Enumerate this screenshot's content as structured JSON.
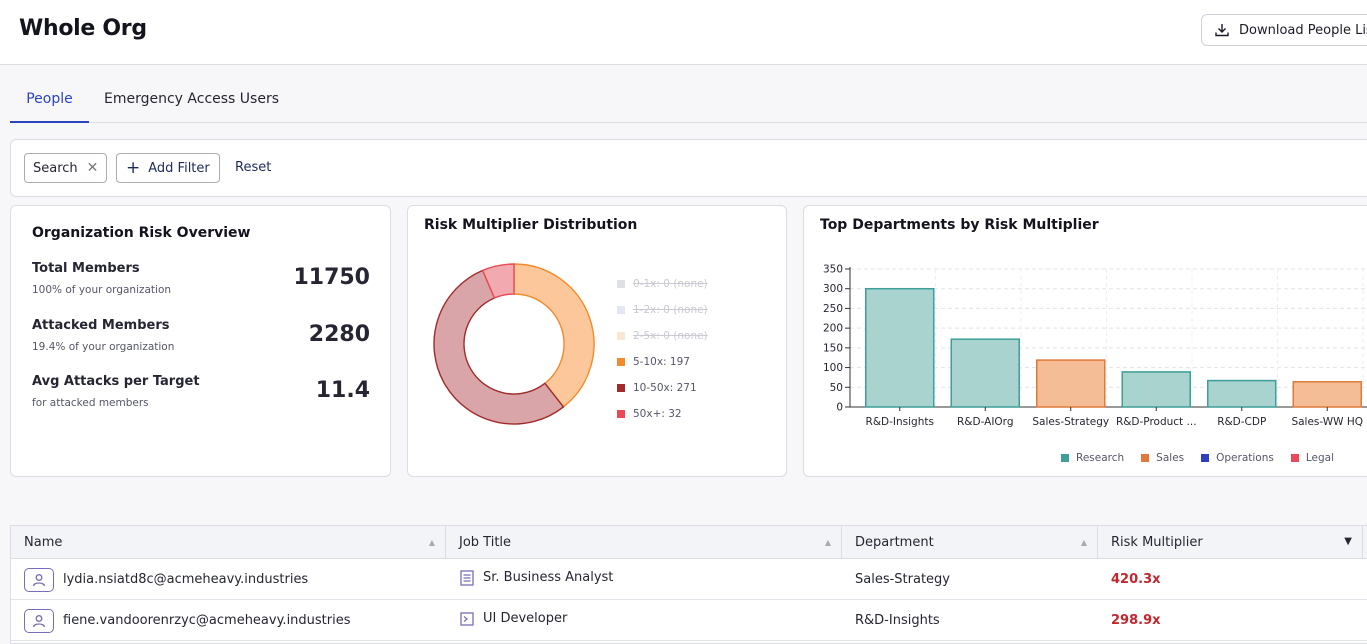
{
  "header": {
    "title": "Whole Org",
    "download_label": "Download People List"
  },
  "tabs": [
    {
      "label": "People",
      "active": true
    },
    {
      "label": "Emergency Access Users",
      "active": false
    }
  ],
  "filters": {
    "search_chip": "Search",
    "add_filter": "Add Filter",
    "reset": "Reset"
  },
  "overview": {
    "title": "Organization Risk Overview",
    "metrics": [
      {
        "label": "Total Members",
        "sub": "100% of your organization",
        "value": "11750"
      },
      {
        "label": "Attacked Members",
        "sub": "19.4% of your organization",
        "value": "2280"
      },
      {
        "label": "Avg Attacks per Target",
        "sub": "for attacked members",
        "value": "11.4"
      }
    ]
  },
  "distribution": {
    "title": "Risk Multiplier Distribution",
    "legend": [
      {
        "label": "0-1x: 0",
        "suffix": "(none)",
        "color": "#dfe0e4",
        "disabled": true
      },
      {
        "label": "1-2x: 0",
        "suffix": "(none)",
        "color": "#e3e8f2",
        "disabled": true
      },
      {
        "label": "2-5x: 0",
        "suffix": "(none)",
        "color": "#fbe8d4",
        "disabled": true
      },
      {
        "label": "5-10x: 197",
        "suffix": "",
        "color": "#f28b2b",
        "disabled": false
      },
      {
        "label": "10-50x: 271",
        "suffix": "",
        "color": "#a12a2a",
        "disabled": false
      },
      {
        "label": "50x+: 32",
        "suffix": "",
        "color": "#e84b55",
        "disabled": false
      }
    ]
  },
  "chart_data": {
    "type": "bar",
    "title": "Top Departments by Risk Multiplier",
    "categories": [
      "R&D-Insights",
      "R&D-AIOrg",
      "Sales-Strategy",
      "R&D-Product ...",
      "R&D-CDP",
      "Sales-WW HQ"
    ],
    "values": [
      300,
      172,
      119,
      89,
      67,
      64
    ],
    "groups": [
      "Research",
      "Research",
      "Sales",
      "Research",
      "Research",
      "Sales"
    ],
    "ylim": [
      0,
      350
    ],
    "yticks": [
      0,
      50,
      100,
      150,
      200,
      250,
      300,
      350
    ],
    "grid": true,
    "legend": [
      {
        "name": "Research",
        "color": "#3e9e98"
      },
      {
        "name": "Sales",
        "color": "#e07a3a"
      },
      {
        "name": "Operations",
        "color": "#2f3fbf"
      },
      {
        "name": "Legal",
        "color": "#e84a5b"
      }
    ],
    "legend_position": "bottom"
  },
  "table": {
    "columns": [
      "Name",
      "Job Title",
      "Department",
      "Risk Multiplier"
    ],
    "rows": [
      {
        "name": "lydia.nsiatd8c@acmeheavy.industries",
        "job": "Sr. Business Analyst",
        "job_icon": "document-icon",
        "dept": "Sales-Strategy",
        "risk": "420.3x"
      },
      {
        "name": "fiene.vandoorenrzyc@acmeheavy.industries",
        "job": "UI Developer",
        "job_icon": "terminal-icon",
        "dept": "R&D-Insights",
        "risk": "298.9x"
      }
    ]
  }
}
